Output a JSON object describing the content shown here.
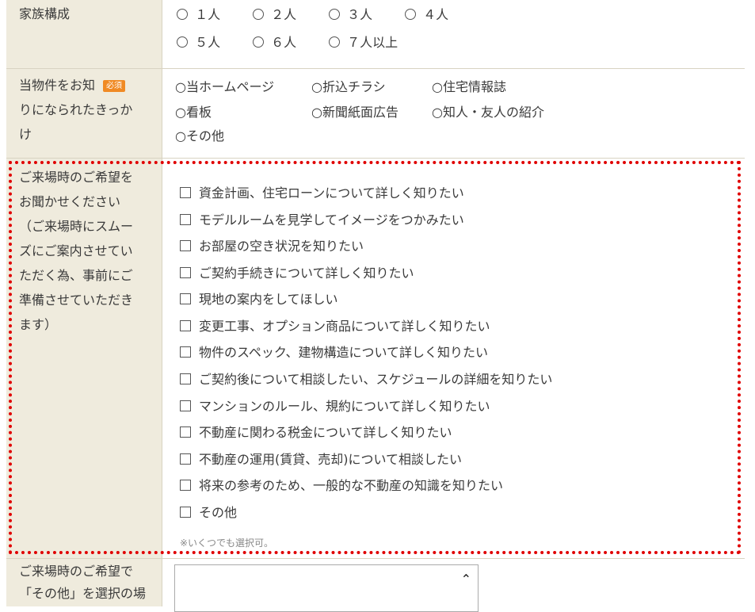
{
  "family": {
    "label": "家族構成",
    "options": [
      "１人",
      "２人",
      "３人",
      "４人",
      "５人",
      "６人",
      "７人以上"
    ]
  },
  "source": {
    "label_line1": "当物件をお知",
    "label_line2": "りになられたきっか",
    "label_line3": "け",
    "required_badge": "必須",
    "options": [
      "当ホームページ",
      "折込チラシ",
      "住宅情報誌",
      "看板",
      "新聞紙面広告",
      "知人・友人の紹介",
      "その他"
    ]
  },
  "wishes": {
    "label_lines": [
      "ご来場時のご希望を",
      "お聞かせください",
      "（ご来場時にスムー",
      "ズにご案内させてい",
      "ただく為、事前にご",
      "準備させていただき",
      "ます）"
    ],
    "items": [
      "資金計画、住宅ローンについて詳しく知りたい",
      "モデルルームを見学してイメージをつかみたい",
      "お部屋の空き状況を知りたい",
      "ご契約手続きについて詳しく知りたい",
      "現地の案内をしてほしい",
      "変更工事、オプション商品について詳しく知りたい",
      "物件のスペック、建物構造について詳しく知りたい",
      "ご契約後について相談したい、スケジュールの詳細を知りたい",
      "マンションのルール、規約について詳しく知りたい",
      "不動産に関わる税金について詳しく知りたい",
      "不動産の運用(賃貸、売却)について相談したい",
      "将来の参考のため、一般的な不動産の知識を知りたい",
      "その他"
    ],
    "note": "※いくつでも選択可。"
  },
  "other": {
    "label_line1": "ご来場時のご希望で",
    "label_line2": "「その他」を選択の場"
  },
  "colors": {
    "label_bg": "#efebdd",
    "highlight": "#e00000",
    "badge": "#f08a24"
  }
}
